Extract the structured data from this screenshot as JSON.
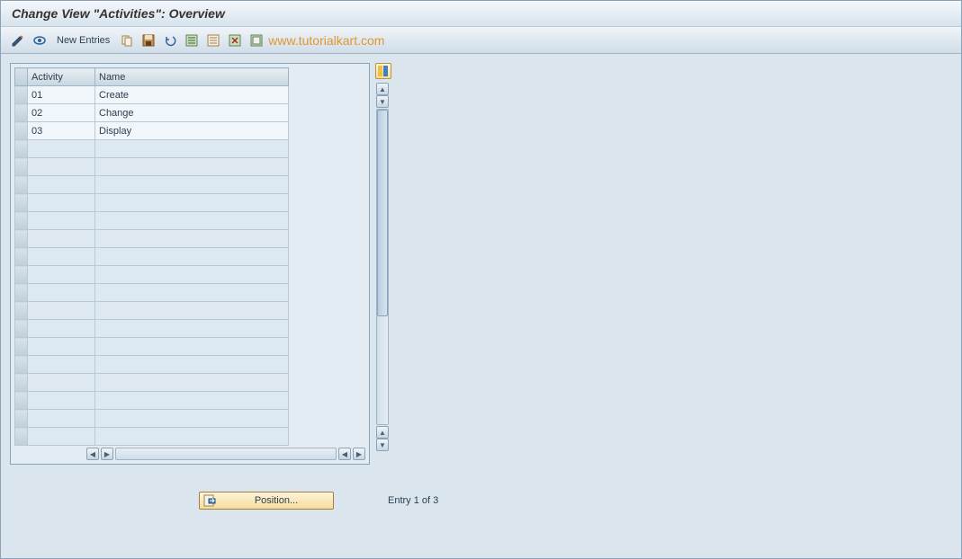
{
  "header": {
    "title": "Change View \"Activities\": Overview"
  },
  "toolbar": {
    "new_entries": "New Entries",
    "watermark": "www.tutorialkart.com"
  },
  "table": {
    "columns": {
      "activity": "Activity",
      "name": "Name"
    },
    "rows": [
      {
        "activity": "01",
        "name": "Create"
      },
      {
        "activity": "02",
        "name": "Change"
      },
      {
        "activity": "03",
        "name": "Display"
      }
    ],
    "empty_rows": 17
  },
  "footer": {
    "position_btn": "Position...",
    "entry_text": "Entry 1 of 3"
  }
}
